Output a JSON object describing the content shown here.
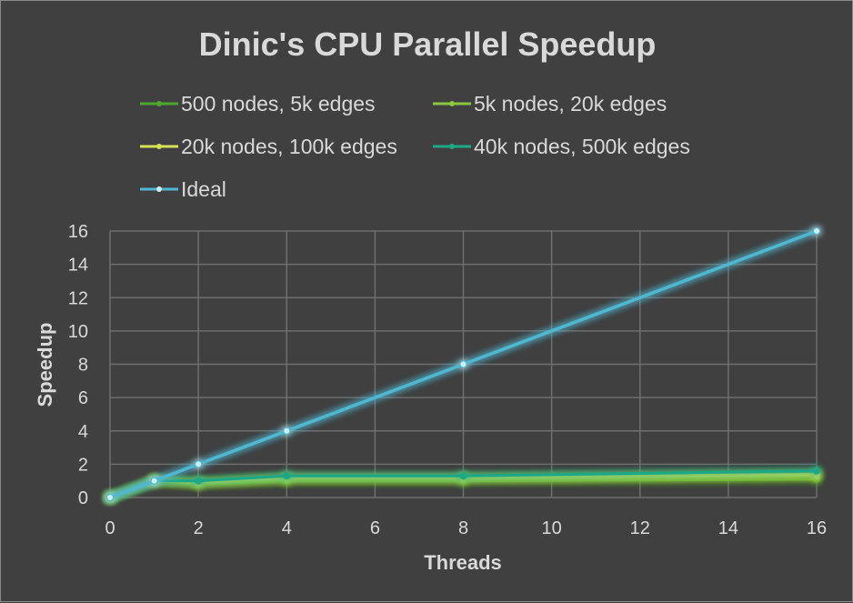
{
  "chart_data": {
    "type": "line",
    "title": "Dinic's CPU Parallel Speedup",
    "xlabel": "Threads",
    "ylabel": "Speedup",
    "xlim": [
      0,
      16
    ],
    "ylim": [
      0,
      16
    ],
    "xticks": [
      0,
      2,
      4,
      6,
      8,
      10,
      12,
      14,
      16
    ],
    "yticks": [
      0,
      2,
      4,
      6,
      8,
      10,
      12,
      14,
      16
    ],
    "grid": true,
    "legend_position": "top",
    "series": [
      {
        "name": "500 nodes, 5k edges",
        "color": "#4ea72e",
        "x": [
          0,
          1,
          2,
          4,
          8,
          16
        ],
        "y": [
          0,
          1.0,
          0.8,
          1.0,
          1.0,
          1.1
        ]
      },
      {
        "name": "5k nodes, 20k edges",
        "color": "#8cc63f",
        "x": [
          0,
          1,
          2,
          4,
          8,
          16
        ],
        "y": [
          0,
          1.0,
          0.85,
          1.1,
          1.1,
          1.3
        ]
      },
      {
        "name": "20k nodes, 100k edges",
        "color": "#d4e157",
        "x": [
          0,
          1,
          2,
          4,
          8,
          16
        ],
        "y": [
          0,
          1.0,
          0.9,
          1.2,
          1.2,
          1.4
        ]
      },
      {
        "name": "40k nodes, 500k edges",
        "color": "#1fa886",
        "x": [
          0,
          1,
          2,
          4,
          8,
          16
        ],
        "y": [
          0,
          1.0,
          1.0,
          1.3,
          1.3,
          1.6
        ]
      },
      {
        "name": "Ideal",
        "color": "#4fb8d0",
        "x": [
          0,
          1,
          2,
          4,
          8,
          16
        ],
        "y": [
          0,
          1,
          2,
          4,
          8,
          16
        ]
      }
    ]
  }
}
